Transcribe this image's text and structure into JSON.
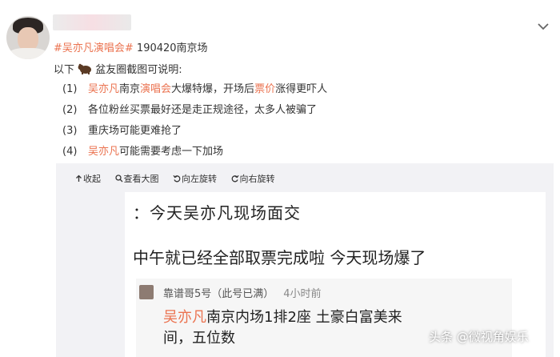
{
  "post": {
    "topic": "#吴亦凡演唱会#",
    "topic_suffix": " 190420南京场",
    "intro_before": "以下",
    "intro_after": "盆友圈截图可说明:",
    "items": [
      {
        "num": "(1)",
        "parts": [
          {
            "t": "吴亦凡",
            "red": true
          },
          {
            "t": "南京",
            "red": false
          },
          {
            "t": "演唱会",
            "red": true
          },
          {
            "t": "大爆特爆，开场后",
            "red": false
          },
          {
            "t": "票价",
            "red": true
          },
          {
            "t": "涨得更吓人",
            "red": false
          }
        ]
      },
      {
        "num": "(2)",
        "parts": [
          {
            "t": "各位粉丝买票最好还是走正规途径，太多人被骗了",
            "red": false
          }
        ]
      },
      {
        "num": "(3)",
        "parts": [
          {
            "t": "重庆场可能更难抢了",
            "red": false
          }
        ]
      },
      {
        "num": "(4)",
        "parts": [
          {
            "t": "吴亦凡",
            "red": true
          },
          {
            "t": "可能需要考虑一下加场",
            "red": false
          }
        ]
      }
    ]
  },
  "toolbar": {
    "collapse": "收起",
    "view_large": "查看大图",
    "rotate_left": "向左旋转",
    "rotate_right": "向右旋转"
  },
  "screenshot": {
    "title": "：今天吴亦凡现场面交",
    "body": "中午就已经全部取票完成啦 今天现场爆了",
    "reply_user": "靠谱哥5号（此号已满）",
    "reply_time": "4小时前",
    "reply_highlight": "吴亦凡",
    "reply_text": "南京内场1排2座 土豪白富美来间，五位数"
  },
  "watermark": "头条 @微视角娱乐",
  "colors": {
    "topic": "#eb7350",
    "card_bg": "#f2f2f5"
  },
  "icons": [
    "chevron-down-icon",
    "arrow-up-icon",
    "magnify-icon",
    "rotate-left-icon",
    "rotate-right-icon",
    "bear-emoji-icon"
  ]
}
